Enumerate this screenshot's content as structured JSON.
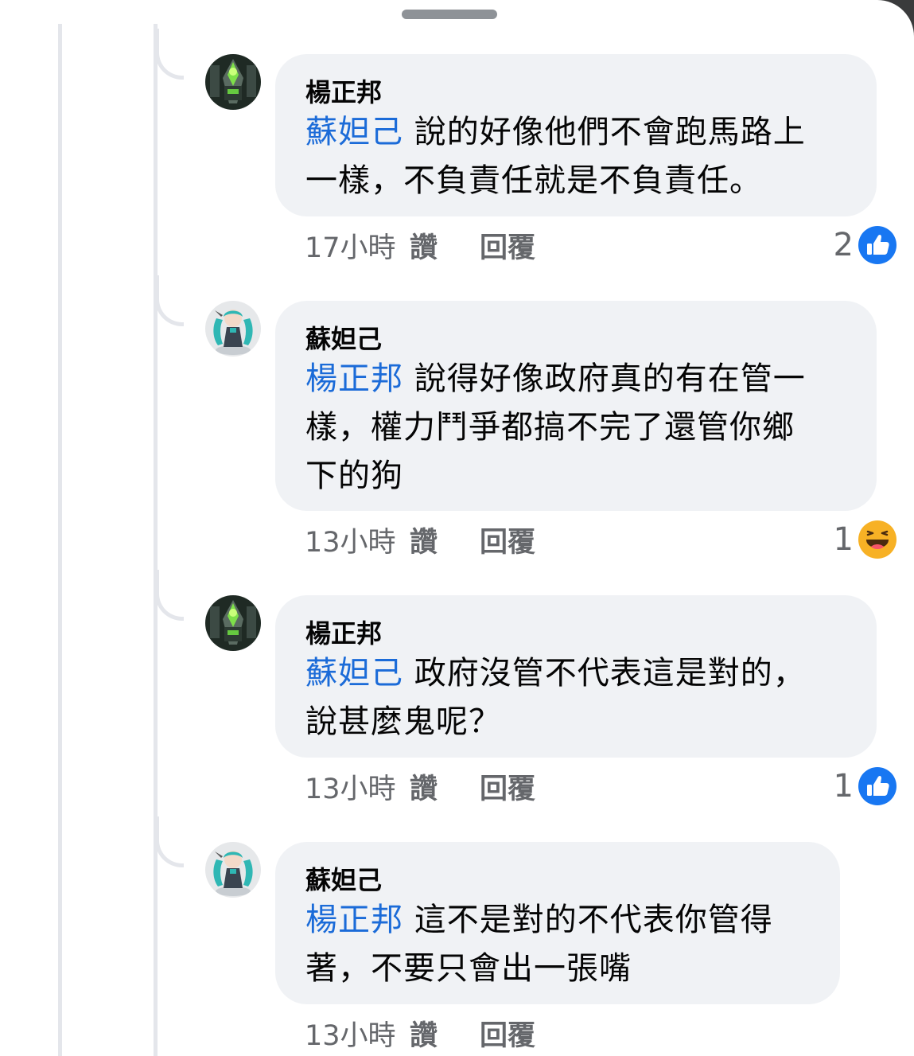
{
  "comments": [
    {
      "author": "楊正邦",
      "mention": "蘇妲己",
      "line1": " 說的好像他們不會跑馬路上",
      "line2": "一樣，不負責任就是不負責任。",
      "line3": "",
      "time": "17小時",
      "like_label": "讚",
      "reply_label": "回覆",
      "reaction_count": "2",
      "reaction_type": "like-icon"
    },
    {
      "author": "蘇妲己",
      "mention": "楊正邦",
      "line1": " 說得好像政府真的有在管一",
      "line2": "樣，權力鬥爭都搞不完了還管你鄉",
      "line3": "下的狗",
      "time": "13小時",
      "like_label": "讚",
      "reply_label": "回覆",
      "reaction_count": "1",
      "reaction_type": "haha-icon"
    },
    {
      "author": "楊正邦",
      "mention": "蘇妲己",
      "line1": " 政府沒管不代表這是對的，",
      "line2": "說甚麼鬼呢？",
      "line3": "",
      "time": "13小時",
      "like_label": "讚",
      "reply_label": "回覆",
      "reaction_count": "1",
      "reaction_type": "like-icon"
    },
    {
      "author": "蘇妲己",
      "mention": "楊正邦",
      "line1": " 這不是對的不代表你管得",
      "line2": "著，不要只會出一張嘴",
      "line3": "",
      "time": "13小時",
      "like_label": "讚",
      "reply_label": "回覆",
      "reaction_count": "",
      "reaction_type": ""
    }
  ],
  "colors": {
    "mention": "#1b6bd8",
    "like_blue": "#1877f2",
    "haha_yellow": "#f7b125",
    "bubble_bg": "#f0f2f5",
    "meta_gray": "#65676b"
  }
}
